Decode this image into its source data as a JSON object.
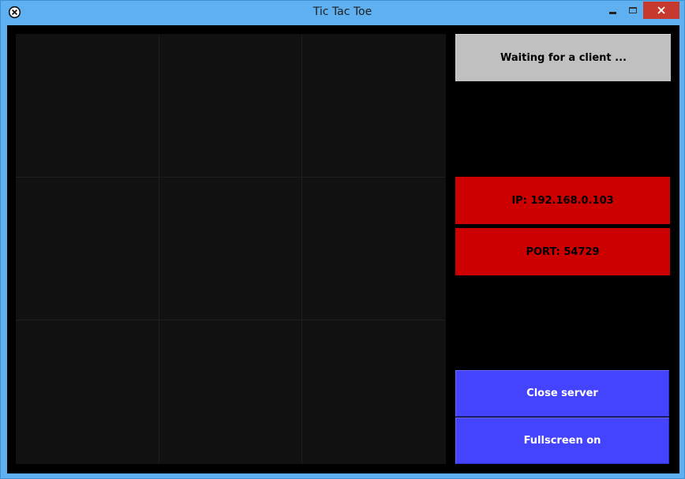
{
  "window": {
    "title": "Tic Tac Toe",
    "icon": "circle-x-icon",
    "controls": [
      "minimize-icon",
      "maximize-icon",
      "close-icon"
    ],
    "colors": {
      "frame": "#5fb0f0",
      "close": "#c7392d"
    }
  },
  "board": {
    "rows": 3,
    "cols": 3,
    "cells": [
      "",
      "",
      "",
      "",
      "",
      "",
      "",
      "",
      ""
    ],
    "colors": {
      "cell": "#111111",
      "background": "#000000"
    }
  },
  "status": {
    "text": "Waiting for a client ...",
    "color": "#c0c0c0"
  },
  "connection": {
    "ip": "IP: 192.168.0.103",
    "port": "PORT: 54729",
    "color": "#cc0000"
  },
  "buttons": {
    "close_server": "Close server",
    "fullscreen": "Fullscreen on",
    "color": "#4444ff"
  }
}
